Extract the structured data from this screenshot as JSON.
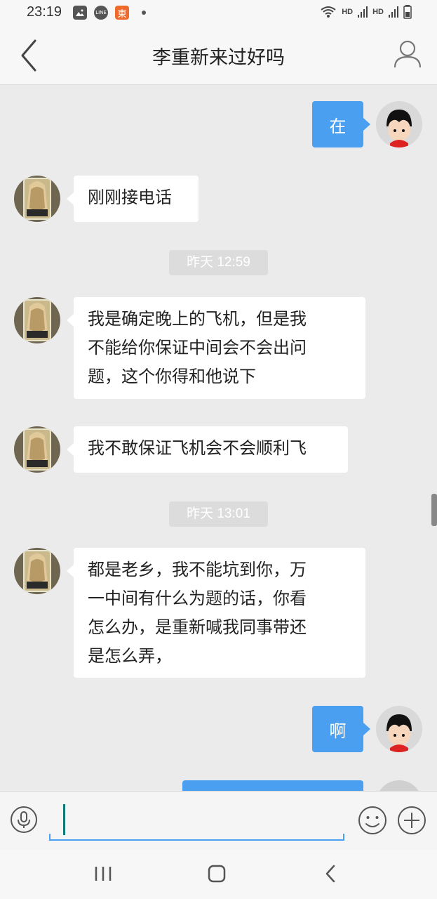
{
  "status_bar": {
    "time": "23:19",
    "notif_icons": [
      "gallery-icon",
      "line-app-icon",
      "taobao-icon"
    ],
    "line_label": "LINE",
    "app_label": "東",
    "hd1": "HD",
    "hd2": "HD"
  },
  "header": {
    "title": "李重新来过好吗",
    "back_icon": "chevron-left-icon",
    "profile_icon": "person-icon"
  },
  "messages": [
    {
      "side": "out",
      "text": "在"
    },
    {
      "side": "in",
      "text": "刚刚接电话"
    },
    {
      "type": "time",
      "text": "昨天 12:59"
    },
    {
      "side": "in",
      "lines": [
        "我是确定晚上的飞机，但是我",
        "不能给你保证中间会不会出问",
        "题，这个你得和他说下"
      ]
    },
    {
      "side": "in",
      "text": "我不敢保证飞机会不会顺利飞"
    },
    {
      "type": "time",
      "text": "昨天 13:01"
    },
    {
      "side": "in",
      "lines": [
        "都是老乡，我不能坑到你，万",
        "一中间有什么为题的话，你看",
        "怎么办，是重新喊我同事带还",
        "是怎么弄，"
      ]
    },
    {
      "side": "out",
      "text": "啊"
    },
    {
      "side": "out",
      "text": ""
    }
  ],
  "input_bar": {
    "value": "",
    "voice_icon": "microphone-icon",
    "emoji_icon": "smiley-icon",
    "more_icon": "plus-circle-icon"
  },
  "nav_bar": {
    "recent_icon": "recent-apps-icon",
    "home_icon": "home-icon",
    "back_icon": "back-icon"
  },
  "colors": {
    "accent": "#4a9ff0",
    "chat_bg": "#ebebeb",
    "bar_bg": "#f7f7f7"
  }
}
